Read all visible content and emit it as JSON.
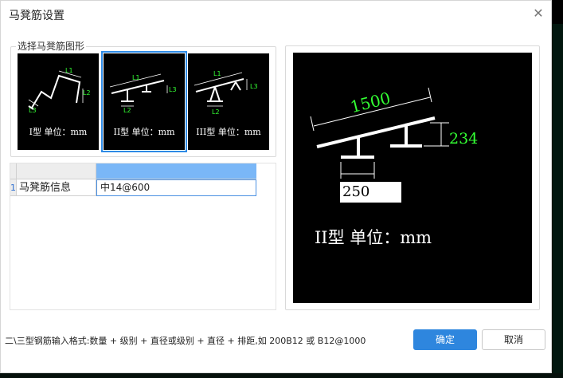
{
  "dialog": {
    "title": "马凳筋设置",
    "close_label": "✕"
  },
  "shape_group": {
    "label": "选择马凳筋图形",
    "options": [
      {
        "caption": "I型 单位：mm",
        "l1": "L1",
        "l2": "L2",
        "l3": "L3"
      },
      {
        "caption": "II型 单位：mm",
        "l1": "L1",
        "l2": "L2",
        "l3": "L3"
      },
      {
        "caption": "III型 单位：mm",
        "l1": "L1",
        "l2": "L2",
        "l3": "L3"
      }
    ],
    "selected_index": 1
  },
  "grid": {
    "row_index": "1",
    "row_label": "马凳筋信息",
    "row_value": "中14@600"
  },
  "preview": {
    "l1_value": "1500",
    "l2_value": "250",
    "l3_value": "234",
    "caption": "II型 单位：mm"
  },
  "hint": "二\\三型钢筋输入格式:数量 + 级别 + 直径或级别 + 直径 + 排距,如 200B12 或 B12@1000",
  "buttons": {
    "ok": "确定",
    "cancel": "取消"
  },
  "colors": {
    "selected_border": "#2d8ae6",
    "header_highlight": "#7ab7f7",
    "ok_button": "#2e86de",
    "dimension_text": "#33ff33"
  }
}
